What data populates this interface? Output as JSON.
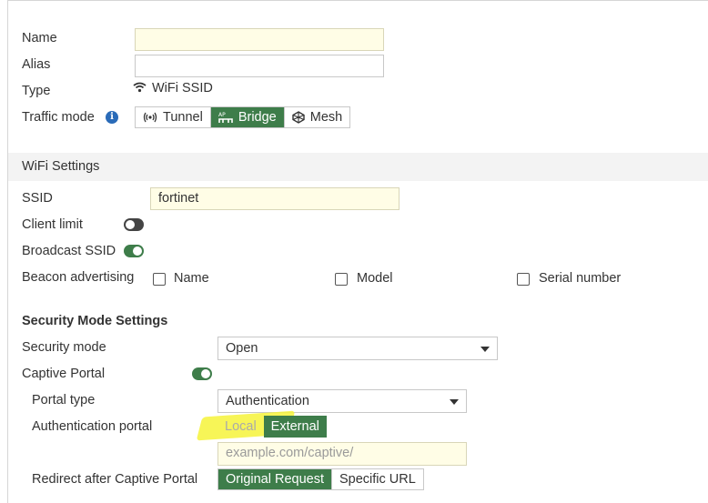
{
  "general": {
    "name_label": "Name",
    "name_value": "",
    "alias_label": "Alias",
    "alias_value": "",
    "type_label": "Type",
    "type_value": "WiFi SSID",
    "traffic_mode_label": "Traffic mode",
    "traffic_mode_options": [
      "Tunnel",
      "Bridge",
      "Mesh"
    ],
    "traffic_mode_selected": "Bridge"
  },
  "wifi": {
    "section_title": "WiFi Settings",
    "ssid_label": "SSID",
    "ssid_value": "fortinet",
    "client_limit_label": "Client limit",
    "client_limit_enabled": false,
    "broadcast_ssid_label": "Broadcast SSID",
    "broadcast_ssid_enabled": true,
    "beacon_label": "Beacon advertising",
    "beacon_options": [
      "Name",
      "Model",
      "Serial number"
    ]
  },
  "security": {
    "section_title": "Security Mode Settings",
    "mode_label": "Security mode",
    "mode_value": "Open",
    "captive_portal_label": "Captive Portal",
    "captive_portal_enabled": true,
    "portal_type_label": "Portal type",
    "portal_type_value": "Authentication",
    "auth_portal_label": "Authentication portal",
    "auth_portal_options": [
      "Local",
      "External"
    ],
    "auth_portal_selected": "External",
    "auth_portal_url_placeholder": "example.com/captive/",
    "redirect_label": "Redirect after Captive Portal",
    "redirect_options": [
      "Original Request",
      "Specific URL"
    ],
    "redirect_selected": "Original Request"
  },
  "colors": {
    "accent_green": "#3e7d4a",
    "info_blue": "#2a6bb8",
    "input_yellow": "#fffde6",
    "highlight_yellow": "#f6f33a"
  }
}
